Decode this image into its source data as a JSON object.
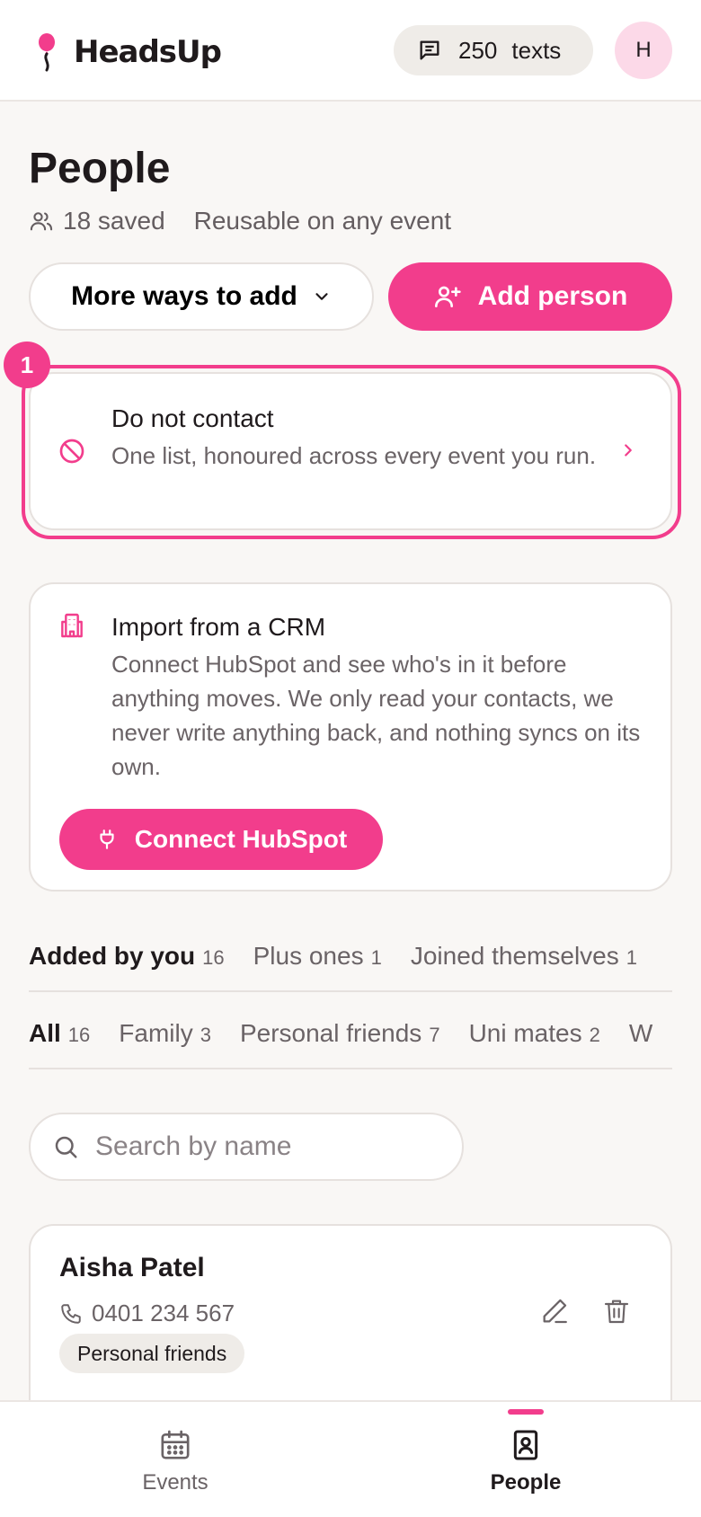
{
  "app": {
    "name": "HeadsUp",
    "credits_count": "250",
    "credits_unit": "texts",
    "avatar_initial": "H"
  },
  "page": {
    "title": "People",
    "saved_count": "18 saved",
    "reusable_note": "Reusable on any event"
  },
  "actions": {
    "more_ways_label": "More ways to add",
    "add_person_label": "Add person"
  },
  "onboarding_badge": "1",
  "do_not_contact": {
    "title": "Do not contact",
    "description": "One list, honoured across every event you run."
  },
  "crm": {
    "title": "Import from a CRM",
    "description": "Connect HubSpot and see who's in it before anything moves. We only read your contacts, we never write anything back, and nothing syncs on its own.",
    "button_label": "Connect HubSpot"
  },
  "source_tabs": [
    {
      "label": "Added by you",
      "count": "16",
      "active": true
    },
    {
      "label": "Plus ones",
      "count": "1",
      "active": false
    },
    {
      "label": "Joined themselves",
      "count": "1",
      "active": false
    }
  ],
  "group_tabs": [
    {
      "label": "All",
      "count": "16",
      "active": true
    },
    {
      "label": "Family",
      "count": "3",
      "active": false
    },
    {
      "label": "Personal friends",
      "count": "7",
      "active": false
    },
    {
      "label": "Uni mates",
      "count": "2",
      "active": false
    },
    {
      "label": "W",
      "count": "",
      "active": false
    }
  ],
  "search": {
    "placeholder": "Search by name"
  },
  "people": [
    {
      "name": "Aisha Patel",
      "phone": "0401 234 567",
      "group": "Personal friends"
    }
  ],
  "bottom_nav": {
    "events_label": "Events",
    "people_label": "People"
  },
  "colors": {
    "accent": "#f23d8c",
    "background": "#f9f7f5",
    "avatar_bg": "#fcd9e8"
  }
}
